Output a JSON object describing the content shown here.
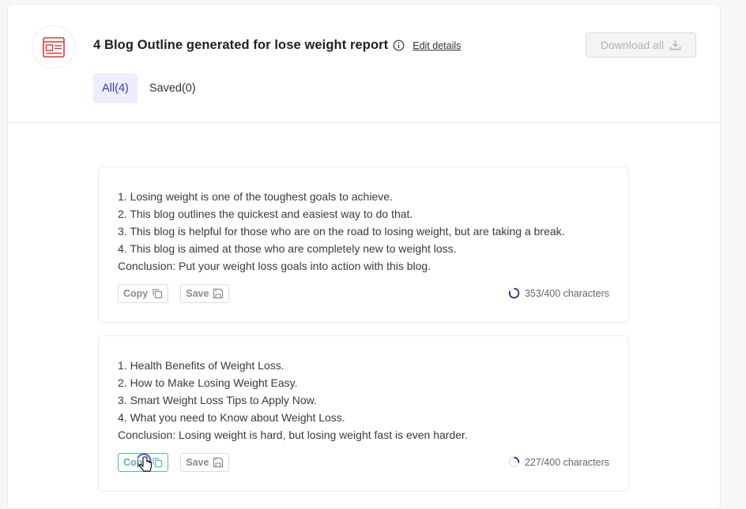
{
  "header": {
    "title": "4 Blog Outline generated for lose weight report",
    "edit_label": "Edit details",
    "download_label": "Download all"
  },
  "tabs": [
    {
      "label": "All(4)",
      "active": true
    },
    {
      "label": "Saved(0)",
      "active": false
    }
  ],
  "cards": [
    {
      "lines": [
        "1. Losing weight is one of the toughest goals to achieve.",
        "2. This blog outlines the quickest and easiest way to do that.",
        "3. This blog is helpful for those who are on the road to losing weight, but are taking a break.",
        "4. This blog is aimed at those who are completely new to weight loss.",
        "Conclusion: Put your weight loss goals into action with this blog."
      ],
      "copy_label": "Copy",
      "save_label": "Save",
      "char_count": "353/400 characters"
    },
    {
      "lines": [
        "1. Health Benefits of Weight Loss.",
        "2. How to Make Losing Weight Easy.",
        "3. Smart Weight Loss Tips to Apply Now.",
        "4. What you need to Know about Weight Loss.",
        "Conclusion: Losing weight is hard, but losing weight fast is even harder."
      ],
      "copy_label": "Copy",
      "save_label": "Save",
      "char_count": "227/400 characters"
    }
  ],
  "colors": {
    "accent": "#3b3bb5",
    "logo_red": "#e03a3a",
    "copy_focus": "#5ab8a8"
  }
}
